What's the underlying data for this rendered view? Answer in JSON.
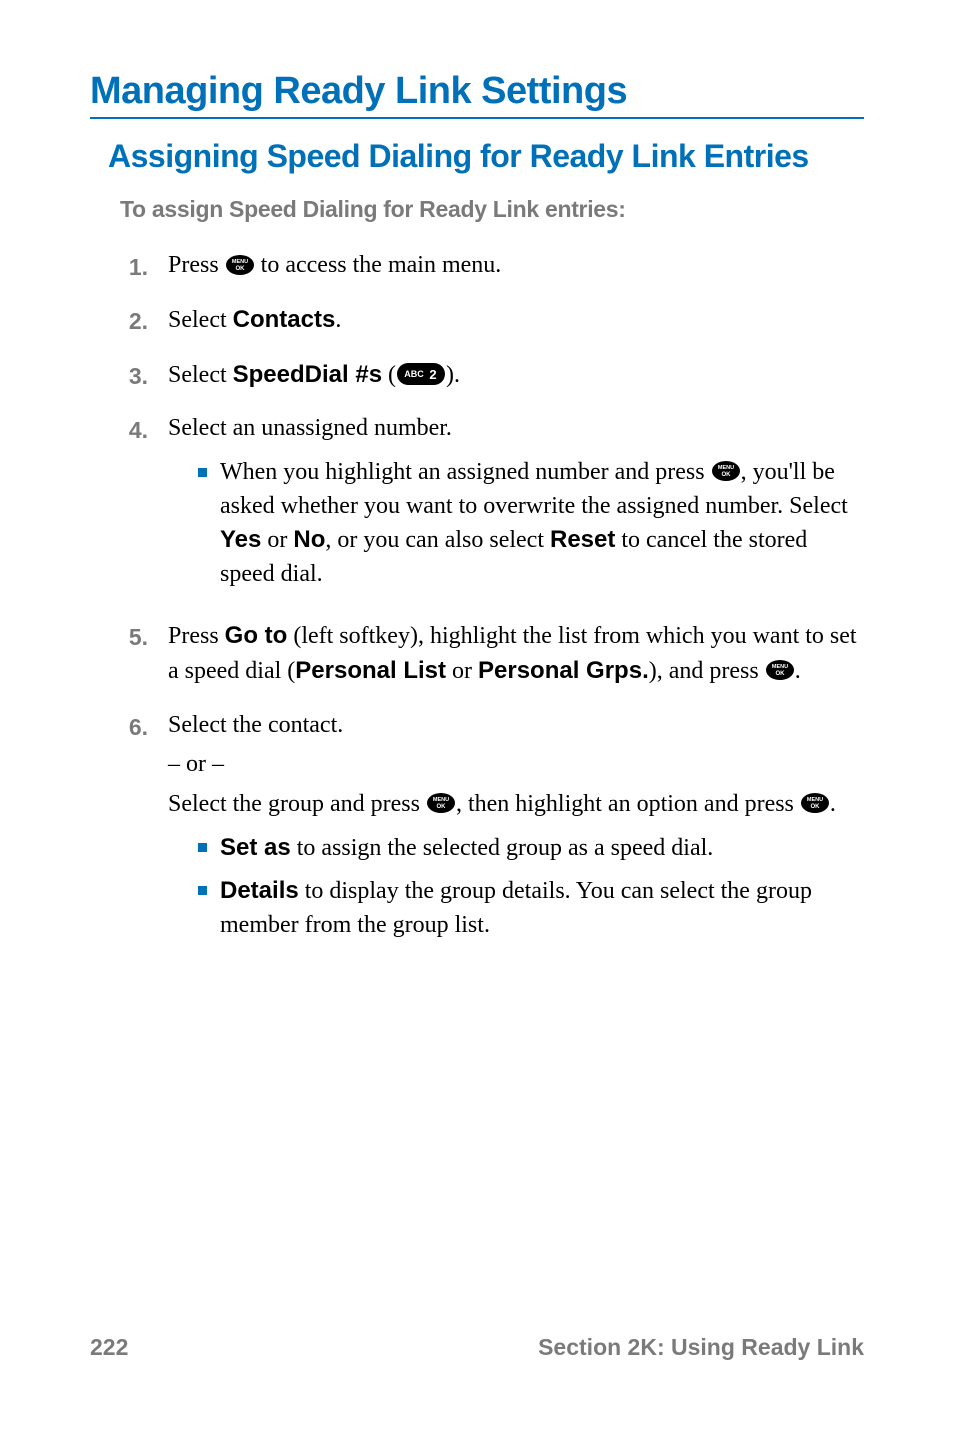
{
  "h1": "Managing Ready Link Settings",
  "h2": "Assigning Speed Dialing for Ready Link Entries",
  "lead": "To assign Speed Dialing for Ready Link entries:",
  "icons": {
    "menu_ok": "MENU OK",
    "abc2": "ABC 2"
  },
  "steps": {
    "s1": {
      "num": "1.",
      "t1": "Press ",
      "t2": " to access the main menu."
    },
    "s2": {
      "num": "2.",
      "t1": "Select ",
      "b1": "Contacts",
      "t2": "."
    },
    "s3": {
      "num": "3.",
      "t1": "Select ",
      "b1": "SpeedDial #s",
      "t2": " (",
      "t3": ")."
    },
    "s4": {
      "num": "4.",
      "t1": "Select an unassigned number.",
      "bullet": {
        "t1": "When you highlight an assigned number and press ",
        "t2": ", you'll be asked whether you want to overwrite the assigned number. Select ",
        "b1": "Yes",
        "t3": " or ",
        "b2": "No",
        "t4": ", or you can also select ",
        "b3": "Reset",
        "t5": " to cancel the stored speed dial."
      }
    },
    "s5": {
      "num": "5.",
      "t1": "Press ",
      "b1": "Go to",
      "t2": " (left softkey), highlight the list from which you want to set a speed dial (",
      "b2": "Personal List",
      "t3": " or ",
      "b3": "Personal Grps.",
      "t4": "), and press ",
      "t5": "."
    },
    "s6": {
      "num": "6.",
      "t1": "Select the contact.",
      "or": "– or –",
      "t2": "Select the group and press ",
      "t3": ", then highlight an option and press ",
      "t4": ".",
      "bullets": {
        "b1": {
          "b": "Set as",
          "t": " to assign the selected group as a speed dial."
        },
        "b2": {
          "b": "Details",
          "t": " to display the group details. You can select the group member from the group list."
        }
      }
    }
  },
  "footer": {
    "page": "222",
    "section": "Section 2K: Using Ready Link"
  }
}
